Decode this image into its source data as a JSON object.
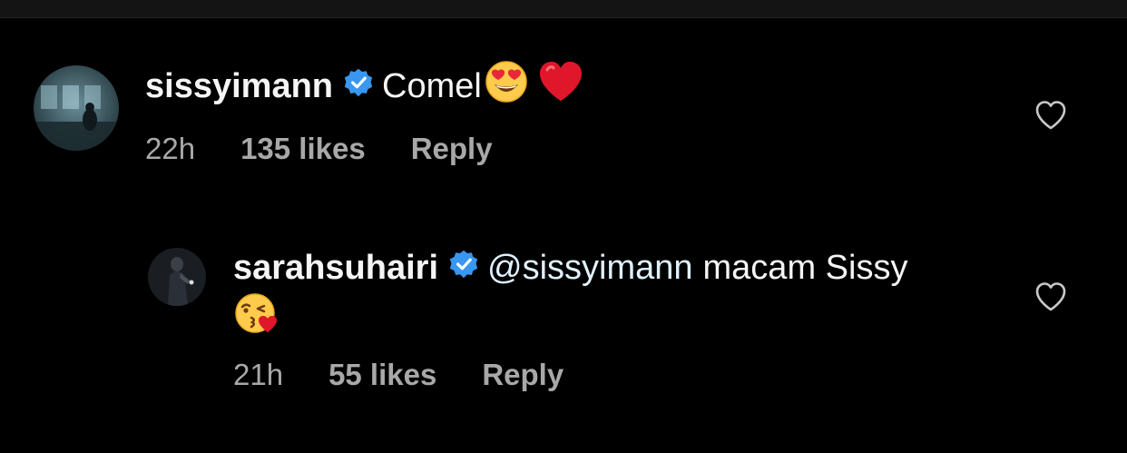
{
  "comments": [
    {
      "username": "sissyimann",
      "verified": true,
      "text": "Comel",
      "emojis": [
        "heart-eyes-emoji",
        "red-heart-emoji"
      ],
      "time": "22h",
      "likes": "135 likes",
      "reply_label": "Reply"
    },
    {
      "username": "sarahsuhairi",
      "verified": true,
      "mention": "@sissyimann",
      "text": "macam Sissy",
      "emojis": [
        "kissing-heart-emoji"
      ],
      "time": "21h",
      "likes": "55 likes",
      "reply_label": "Reply"
    }
  ],
  "icons": {
    "like": "heart-outline-icon",
    "verified": "verified-badge-icon"
  },
  "colors": {
    "background": "#000000",
    "primary_text": "#f5f5f5",
    "secondary_text": "#a8a8a8",
    "verified_blue": "#3897f0",
    "mention": "#e0f1ff"
  }
}
